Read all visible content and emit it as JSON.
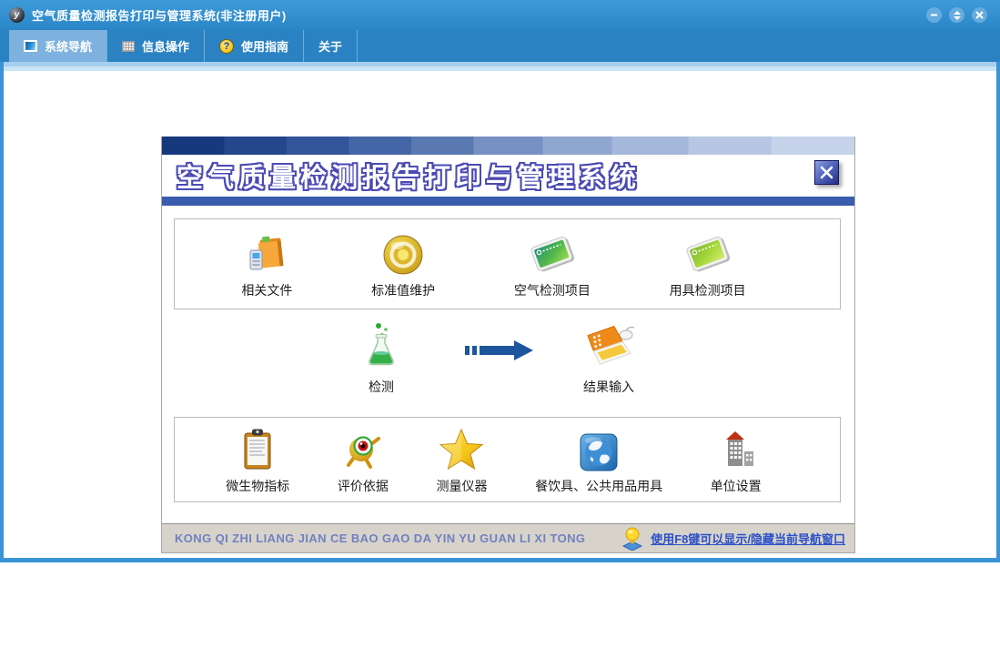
{
  "glyphs": {
    "app": "y",
    "question": "?"
  },
  "titlebar": {
    "title": "空气质量检测报告打印与管理系统(非注册用户)",
    "app_icon": "y-sphere-icon",
    "controls": [
      "minimize",
      "restore",
      "close"
    ]
  },
  "tabs": [
    {
      "label": "系统导航",
      "icon": "monitor-icon",
      "active": true
    },
    {
      "label": "信息操作",
      "icon": "grid-icon",
      "active": false
    },
    {
      "label": "使用指南",
      "icon": "help-icon",
      "active": false
    },
    {
      "label": "关于",
      "icon": "",
      "active": false
    }
  ],
  "panel": {
    "title": "空气质量检测报告打印与管理系统",
    "close_icon": "close-x-icon",
    "rows": {
      "top": [
        {
          "label": "相关文件",
          "icon": "folder-files-icon"
        },
        {
          "label": "标准值维护",
          "icon": "target-rings-icon"
        },
        {
          "label": "空气检测项目",
          "icon": "air-test-card-icon"
        },
        {
          "label": "用具检测项目",
          "icon": "tool-test-card-icon"
        }
      ],
      "middle": {
        "detect": {
          "label": "检测",
          "icon": "flask-icon"
        },
        "arrow_icon": "flow-arrow-icon",
        "result": {
          "label": "结果输入",
          "icon": "laptop-input-icon"
        }
      },
      "bottom": [
        {
          "label": "微生物指标",
          "icon": "clipboard-icon"
        },
        {
          "label": "评价依据",
          "icon": "eye-creature-icon"
        },
        {
          "label": "测量仪器",
          "icon": "star-icon"
        },
        {
          "label": "餐饮具、公共用品用具",
          "icon": "globe-icon"
        },
        {
          "label": "单位设置",
          "icon": "buildings-icon"
        }
      ]
    },
    "statusbar": {
      "pinyin": "KONG QI ZHI LIANG JIAN CE BAO GAO DA YIN YU GUAN LI XI TONG",
      "hint": "使用F8键可以显示/隐藏当前导航窗口",
      "hint_icon": "bulb-icon"
    }
  },
  "colors": {
    "titlebar_blue": "#2f8cce",
    "tabstrip_blue": "#2a82c3",
    "active_tab_blue": "#7db2de",
    "frame_blue": "#3a93d6",
    "panel_divider_blue": "#3a5cac",
    "title_outline_blue": "#4a4ab4",
    "status_bg": "#d7d3cb",
    "status_text_blue": "#7181c0",
    "link_blue": "#2b50c8",
    "arrow_navy": "#1e569e"
  }
}
